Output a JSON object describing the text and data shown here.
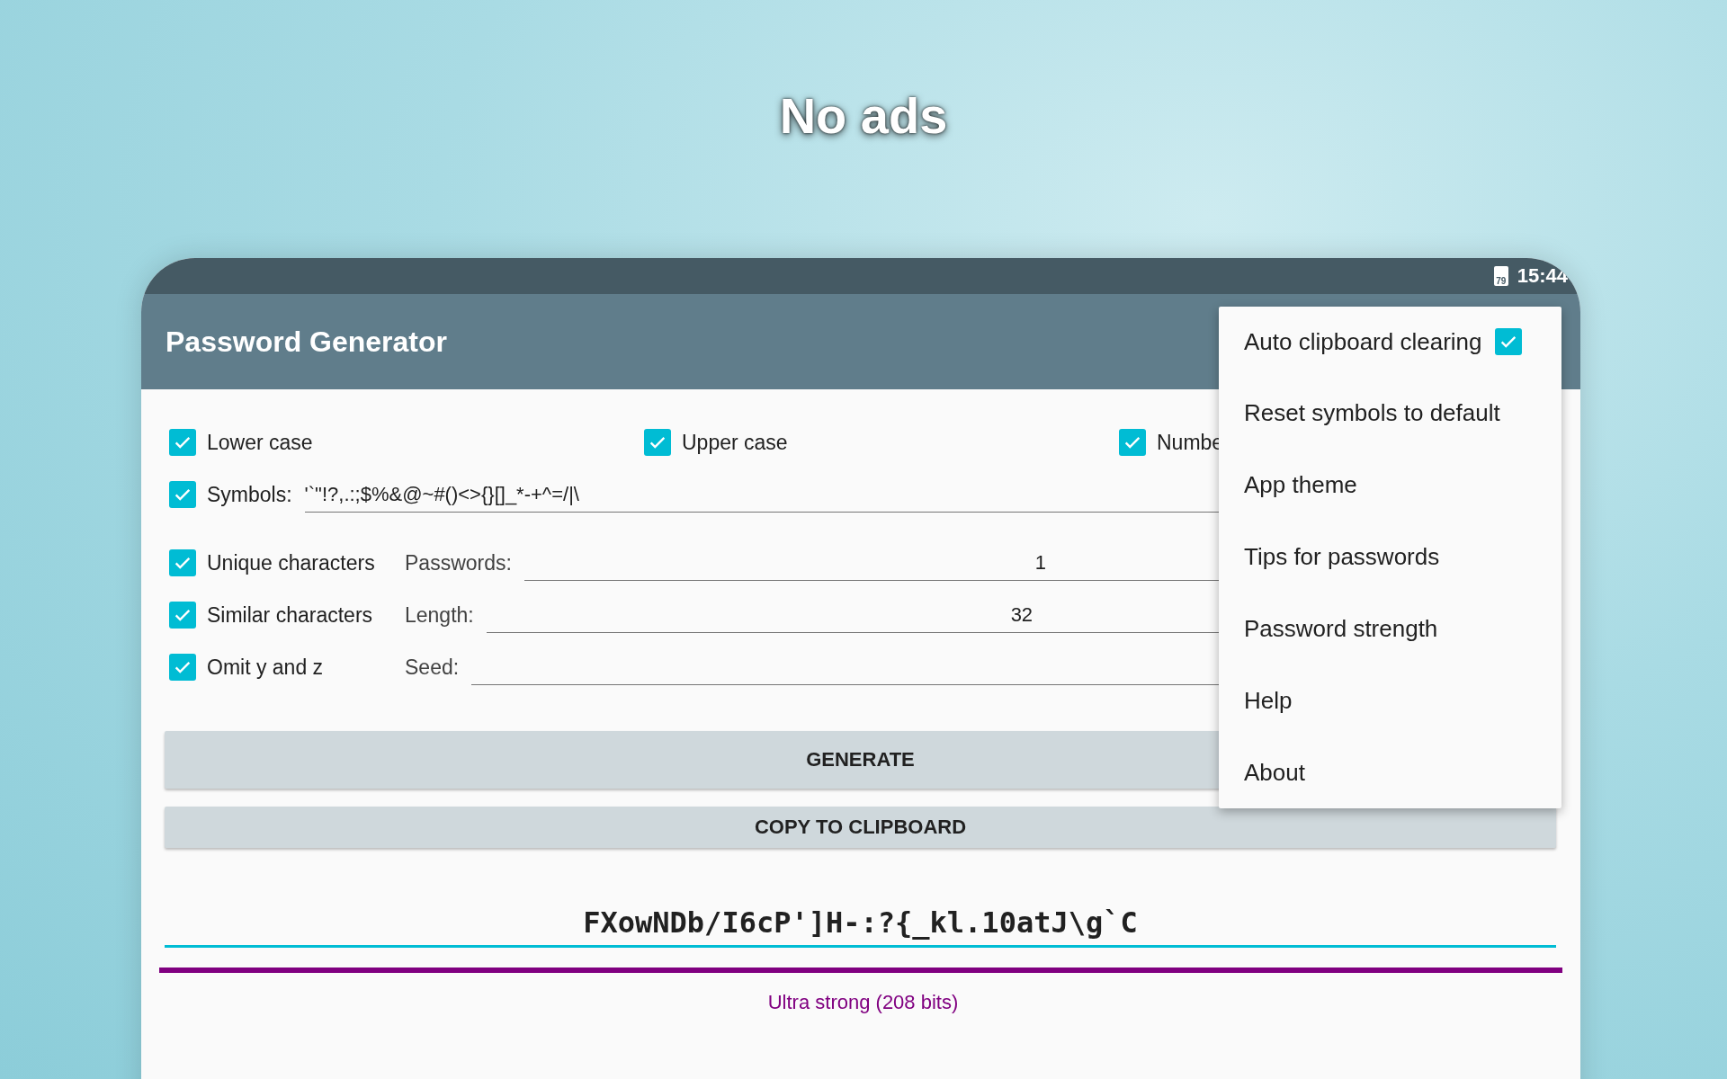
{
  "headline": "No ads",
  "status_bar": {
    "battery": "79",
    "time": "15:44"
  },
  "app_bar": {
    "title": "Password Generator"
  },
  "char_options": [
    {
      "label": "Lower case",
      "checked": true
    },
    {
      "label": "Upper case",
      "checked": true
    },
    {
      "label": "Numbe",
      "checked": true
    }
  ],
  "symbols": {
    "label": "Symbols:",
    "checked": true,
    "value": "'`\"!?,.:;$%&@~#()<>{}[]_*-+^=/|\\"
  },
  "options": [
    {
      "label": "Unique characters",
      "checked": true,
      "field_label": "Passwords:",
      "value": "1"
    },
    {
      "label": "Similar characters",
      "checked": true,
      "field_label": "Length:",
      "value": "32"
    },
    {
      "label": "Omit y and z",
      "checked": true,
      "field_label": "Seed:"
    }
  ],
  "buttons": [
    "GENERATE",
    "COPY TO CLIPBOARD"
  ],
  "password": {
    "value": "FXowNDb/I6cP']H-:?{_kl.10atJ\\g`C",
    "focused": true
  },
  "strength": {
    "level": 1,
    "label": "Ultra strong (208 bits)",
    "color": "#800080"
  },
  "menu": [
    {
      "label": "Auto clipboard clearing",
      "kind": "checkbox",
      "checked": true
    },
    {
      "label": "Reset symbols to default",
      "kind": "item"
    },
    {
      "label": "App theme",
      "kind": "item"
    },
    {
      "label": "Tips for passwords",
      "kind": "item"
    },
    {
      "label": "Password strength",
      "kind": "item"
    },
    {
      "label": "Help",
      "kind": "item"
    },
    {
      "label": "About",
      "kind": "item"
    }
  ]
}
